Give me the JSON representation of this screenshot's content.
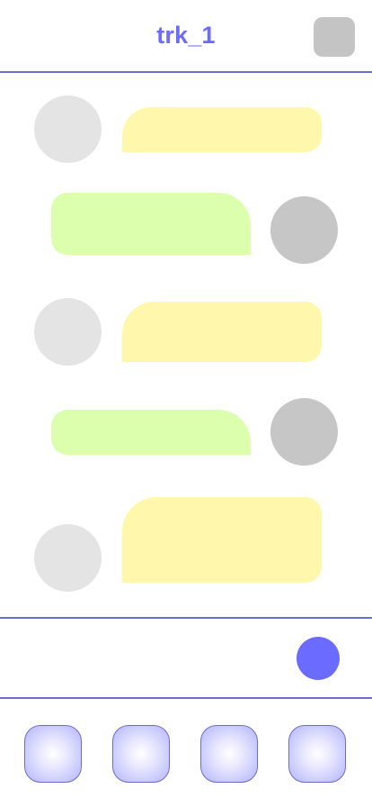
{
  "header": {
    "title": "trk_1",
    "action_icon": "square-icon"
  },
  "messages": [
    {
      "side": "left",
      "bubble_color": "#fff7ac",
      "avatar_color": "#e4e4e4"
    },
    {
      "side": "right",
      "bubble_color": "#dcffad",
      "avatar_color": "#c6c6c6"
    },
    {
      "side": "left",
      "bubble_color": "#fff7ac",
      "avatar_color": "#e4e4e4"
    },
    {
      "side": "right",
      "bubble_color": "#dcffad",
      "avatar_color": "#c6c6c6"
    },
    {
      "side": "left",
      "bubble_color": "#fff7ac",
      "avatar_color": "#e4e4e4"
    }
  ],
  "composer": {
    "send_icon": "circle-send-icon"
  },
  "tabs": [
    {
      "icon": "tab-icon-1"
    },
    {
      "icon": "tab-icon-2"
    },
    {
      "icon": "tab-icon-3"
    },
    {
      "icon": "tab-icon-4"
    }
  ],
  "colors": {
    "accent": "#6b6bff",
    "divider": "#6b6bd6",
    "bubble_in": "#fff7ac",
    "bubble_out": "#dcffad"
  }
}
